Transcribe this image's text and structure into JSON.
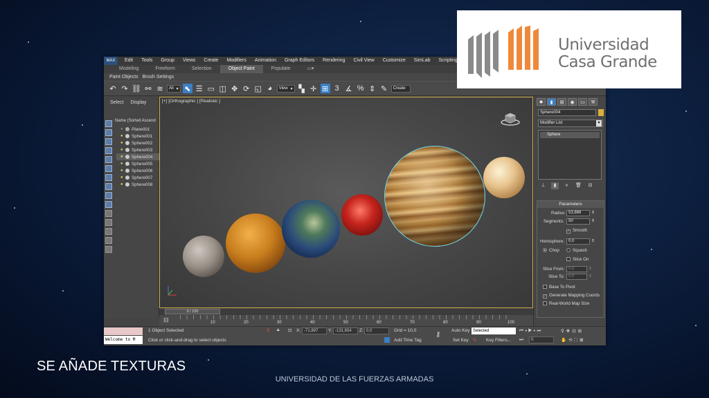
{
  "slide": {
    "title": "SE AÑADE TEXTURAS",
    "footer": "UNIVERSIDAD DE LAS FUERZAS ARMADAS"
  },
  "logo": {
    "line1": "Universidad",
    "line2": "Casa Grande",
    "colors": {
      "grey": "#8a8a8a",
      "orange": "#f0883a"
    }
  },
  "max": {
    "app_badge": "MAX",
    "menu": [
      "Edit",
      "Tools",
      "Group",
      "Views",
      "Create",
      "Modifiers",
      "Animation",
      "Graph Editors",
      "Rendering",
      "Civil View",
      "Customize",
      "SimLab",
      "Scripting"
    ],
    "ribbon_tabs": [
      "Modeling",
      "Freeform",
      "Selection",
      "Object Paint",
      "Populate"
    ],
    "ribbon_active": "Object Paint",
    "subribbon": [
      "Paint Objects",
      "Brush Settings"
    ],
    "toolbar": {
      "filter_value": "All",
      "view_value": "View",
      "create_placeholder": "Create",
      "snap_label": "3"
    },
    "scene_explorer": {
      "tabs": [
        "Select",
        "Display"
      ],
      "header": "Name (Sorted Ascend",
      "items": [
        "Plane001",
        "Sphere001",
        "Sphere002",
        "Sphere003",
        "Sphere004",
        "Sphere005",
        "Sphere006",
        "Sphere007",
        "Sphere008"
      ],
      "selected": "Sphere004"
    },
    "viewport": {
      "label": "[+] [Orthographic ] [Realistic ]"
    },
    "timeline": {
      "slider": "0 / 100",
      "ticks": [
        "10",
        "20",
        "30",
        "40",
        "50",
        "60",
        "70",
        "80",
        "90",
        "100"
      ]
    },
    "status": {
      "maxscript": "Welcome to M",
      "selection": "1 Object Selected",
      "prompt": "Click or click-and-drag to select objects",
      "x_label": "X:",
      "x_value": "-71,897",
      "y_label": "Y:",
      "y_value": "-131,654",
      "z_label": "Z:",
      "z_value": "0,0",
      "grid": "Grid = 10,0",
      "add_time_tag": "Add Time Tag",
      "auto_key": "Auto Key",
      "set_key": "Set Key",
      "key_mode_value": "Selected",
      "key_filters": "Key Filters...",
      "frame_value": "0"
    },
    "command_panel": {
      "object_name": "Sphere004",
      "modifier_list": "Modifier List",
      "stack_item": "Sphere",
      "rollout_title": "Parameters",
      "radius_label": "Radius:",
      "radius_value": "53,886",
      "segments_label": "Segments:",
      "segments_value": "50",
      "smooth_label": "Smooth",
      "hemisphere_label": "Hemisphere:",
      "hemisphere_value": "0,0",
      "chop_label": "Chop",
      "squash_label": "Squash",
      "slice_on_label": "Slice On",
      "slice_from_label": "Slice From:",
      "slice_from_value": "0,0",
      "slice_to_label": "Slice To:",
      "slice_to_value": "0,0",
      "base_to_pivot_label": "Base To Pivot",
      "gen_mapping_label": "Generate Mapping Coords",
      "real_world_label": "Real-World Map Size"
    }
  }
}
